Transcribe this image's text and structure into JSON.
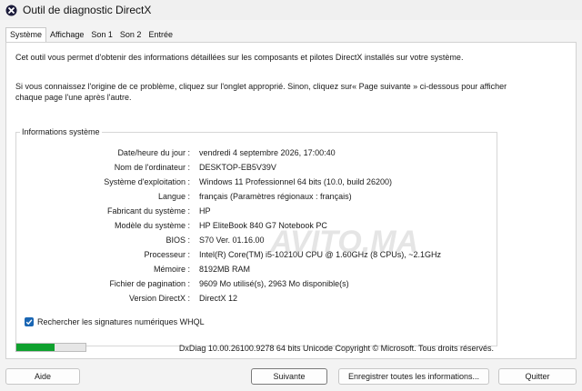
{
  "window": {
    "title": "Outil de diagnostic DirectX",
    "icon": "directx-x-icon"
  },
  "tabs": [
    {
      "label": "Système",
      "active": true
    },
    {
      "label": "Affichage",
      "active": false
    },
    {
      "label": "Son 1",
      "active": false
    },
    {
      "label": "Son 2",
      "active": false
    },
    {
      "label": "Entrée",
      "active": false
    }
  ],
  "intro": {
    "line1": "Cet outil vous permet d'obtenir des informations détaillées sur les composants et pilotes DirectX installés sur votre système.",
    "line2": "Si vous connaissez l'origine de ce problème, cliquez sur l'onglet approprié. Sinon, cliquez sur« Page suivante » ci-dessous pour afficher chaque page l'une après l'autre."
  },
  "system_info": {
    "title": "Informations système",
    "rows": [
      {
        "label": "Date/heure du jour :",
        "value": "vendredi 4 septembre 2026, 17:00:40"
      },
      {
        "label": "Nom de l'ordinateur :",
        "value": "DESKTOP-EB5V39V"
      },
      {
        "label": "Système d'exploitation :",
        "value": "Windows 11 Professionnel 64 bits (10.0, build 26200)"
      },
      {
        "label": "Langue :",
        "value": "français (Paramètres régionaux : français)"
      },
      {
        "label": "Fabricant du système :",
        "value": "HP"
      },
      {
        "label": "Modèle du système :",
        "value": "HP EliteBook 840 G7 Notebook PC"
      },
      {
        "label": "BIOS :",
        "value": "S70 Ver. 01.16.00"
      },
      {
        "label": "Processeur :",
        "value": "Intel(R) Core(TM) i5-10210U CPU @ 1.60GHz (8 CPUs), ~2.1GHz"
      },
      {
        "label": "Mémoire :",
        "value": "8192MB RAM"
      },
      {
        "label": "Fichier de pagination :",
        "value": "9609 Mo utilisé(s), 2963 Mo disponible(s)"
      },
      {
        "label": "Version DirectX :",
        "value": "DirectX 12"
      }
    ]
  },
  "whql_checkbox": {
    "label": "Rechercher les signatures numériques WHQL",
    "checked": true
  },
  "progress": {
    "fraction": 0.55,
    "fill_color": "#0fa12e"
  },
  "footer": {
    "copyright": "DxDiag 10.00.26100.9278 64 bits Unicode Copyright © Microsoft. Tous droits réservés."
  },
  "buttons": {
    "help": "Aide",
    "next": "Suivante",
    "save": "Enregistrer toutes les informations...",
    "quit": "Quitter"
  },
  "watermark": "AVITO.MA"
}
